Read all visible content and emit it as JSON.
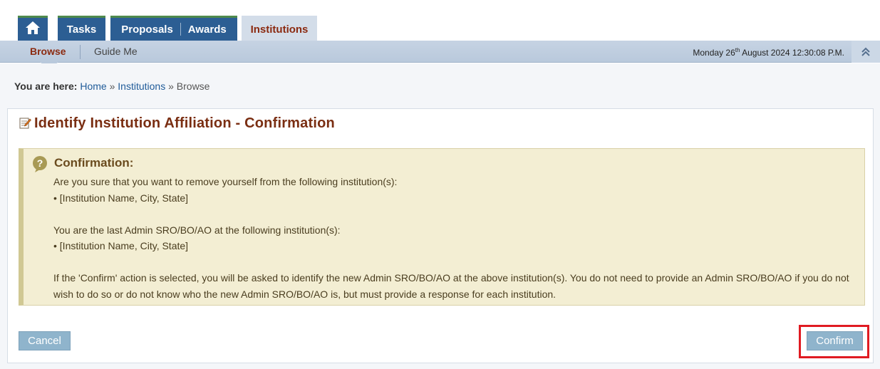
{
  "nav": {
    "home_icon": "home-icon",
    "tabs": [
      "Tasks",
      "Proposals",
      "Awards",
      "Institutions"
    ]
  },
  "subnav": {
    "browse": "Browse",
    "guide_me": "Guide Me",
    "date_prefix": "Monday 26",
    "date_sup": "th",
    "date_suffix": " August 2024 12:30:08 P.M."
  },
  "breadcrumb": {
    "label": "You are here:",
    "home": "Home",
    "sep1": "»",
    "institutions": "Institutions",
    "sep2": "»",
    "current": "Browse"
  },
  "page": {
    "title": "Identify Institution Affiliation - Confirmation"
  },
  "notice": {
    "heading": "Confirmation:",
    "line1": "Are you sure that you want to remove yourself from the following institution(s):",
    "line2": "• [Institution Name, City, State]",
    "line3": "You are the last Admin SRO/BO/AO at the following institution(s):",
    "line4": "• [Institution Name, City, State]",
    "line5": "If the 'Confirm' action is selected, you will be asked to identify the new Admin SRO/BO/AO at the above institution(s). You do not need to provide an Admin SRO/BO/AO if you do not wish to do so or do not know who the new Admin SRO/BO/AO is, but must provide a response for each institution."
  },
  "buttons": {
    "cancel": "Cancel",
    "confirm": "Confirm"
  },
  "colors": {
    "nav_blue": "#2c5e93",
    "accent_red": "#8b2a10",
    "highlight_red": "#e01b22"
  }
}
